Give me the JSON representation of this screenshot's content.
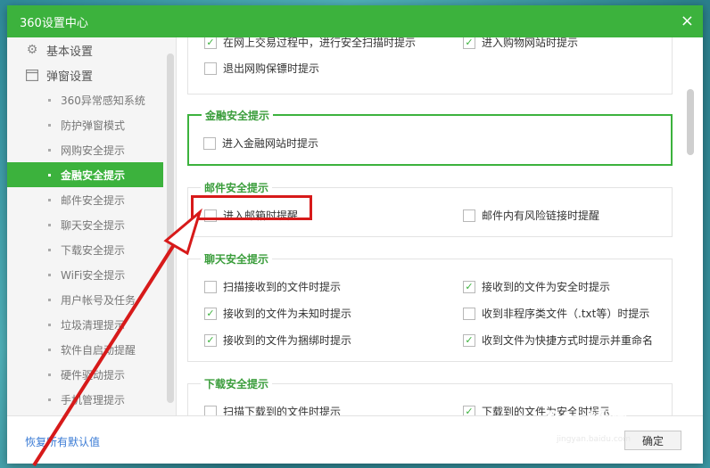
{
  "window": {
    "title": "360设置中心",
    "close": "×"
  },
  "sidebar": {
    "top_items": [
      {
        "label": "基本设置",
        "icon": "gear-icon"
      },
      {
        "label": "弹窗设置",
        "icon": "window-icon"
      }
    ],
    "sub_items": [
      {
        "label": "360异常感知系统"
      },
      {
        "label": "防护弹窗模式"
      },
      {
        "label": "网购安全提示"
      },
      {
        "label": "金融安全提示",
        "active": true
      },
      {
        "label": "邮件安全提示"
      },
      {
        "label": "聊天安全提示"
      },
      {
        "label": "下载安全提示"
      },
      {
        "label": "WiFi安全提示"
      },
      {
        "label": "用户帐号及任务"
      },
      {
        "label": "垃圾清理提示"
      },
      {
        "label": "软件自启动提醒"
      },
      {
        "label": "硬件驱动提示"
      },
      {
        "label": "手机管理提示"
      }
    ]
  },
  "content": {
    "shopping": {
      "options": [
        {
          "label": "在网上交易过程中，进行安全扫描时提示",
          "checked": true
        },
        {
          "label": "进入购物网站时提示",
          "checked": true
        },
        {
          "label": "退出网购保镖时提示",
          "checked": false
        }
      ]
    },
    "finance": {
      "title": "金融安全提示",
      "options": [
        {
          "label": "进入金融网站时提示",
          "checked": false
        }
      ]
    },
    "mail": {
      "title": "邮件安全提示",
      "options": [
        {
          "label": "进入邮箱时提醒",
          "checked": false
        },
        {
          "label": "邮件内有风险链接时提醒",
          "checked": false
        }
      ]
    },
    "chat": {
      "title": "聊天安全提示",
      "options": [
        {
          "label": "扫描接收到的文件时提示",
          "checked": false
        },
        {
          "label": "接收到的文件为安全时提示",
          "checked": true
        },
        {
          "label": "接收到的文件为未知时提示",
          "checked": true
        },
        {
          "label": "收到非程序类文件（.txt等）时提示",
          "checked": false
        },
        {
          "label": "接收到的文件为捆绑时提示",
          "checked": true
        },
        {
          "label": "收到文件为快捷方式时提示并重命名",
          "checked": true
        }
      ]
    },
    "download": {
      "title": "下载安全提示",
      "options": [
        {
          "label": "扫描下载到的文件时提示",
          "checked": false
        },
        {
          "label": "下载到的文件为安全时提示",
          "checked": true
        }
      ]
    }
  },
  "footer": {
    "restore": "恢复所有默认值",
    "ok": "确定"
  },
  "watermark": {
    "brand": "Bai 经验",
    "url": "jingyan.baidu.com"
  },
  "colors": {
    "accent": "#3cb23d",
    "highlight_red": "#d71a1a",
    "link": "#3a7bd5"
  }
}
